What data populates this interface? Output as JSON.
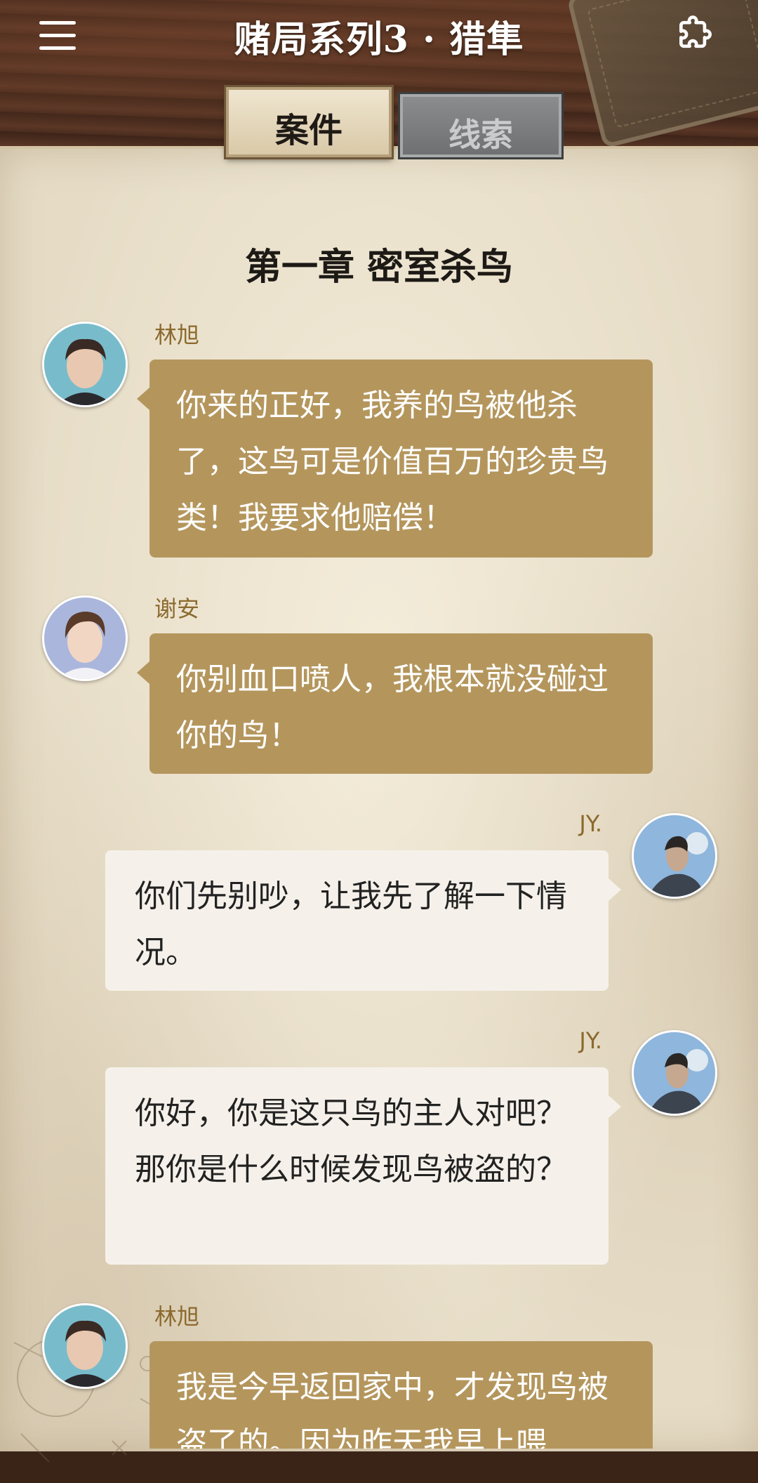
{
  "header": {
    "title": "赌局系列3 · 猎隼",
    "menu_icon": "hamburger-menu-icon",
    "puzzle_icon": "puzzle-piece-icon"
  },
  "tabs": [
    {
      "label": "案件",
      "active": true
    },
    {
      "label": "线索",
      "active": false
    }
  ],
  "chapter": {
    "title": "第一章 密室杀鸟"
  },
  "messages": [
    {
      "sender": "林旭",
      "side": "left",
      "text": "你来的正好，我养的鸟被他杀了，这鸟可是价值百万的珍贵鸟类！我要求他赔偿！"
    },
    {
      "sender": "谢安",
      "side": "left",
      "text": "你别血口喷人，我根本就没碰过你的鸟！"
    },
    {
      "sender": "JY.",
      "side": "right",
      "text": "你们先别吵，让我先了解一下情况。"
    },
    {
      "sender": "JY.",
      "side": "right",
      "text": "你好，你是这只鸟的主人对吧？那你是什么时候发现鸟被盗的？"
    },
    {
      "sender": "林旭",
      "side": "left",
      "text": "我是今早返回家中，才发现鸟被盗了的。因为昨天我早上喂"
    }
  ],
  "colors": {
    "bubble_npc": "#b4965d",
    "bubble_player": "#f5f1ea",
    "sender_name": "#8b6a2e",
    "parchment": "#e6dcc6",
    "wood": "#4a2c1e"
  }
}
